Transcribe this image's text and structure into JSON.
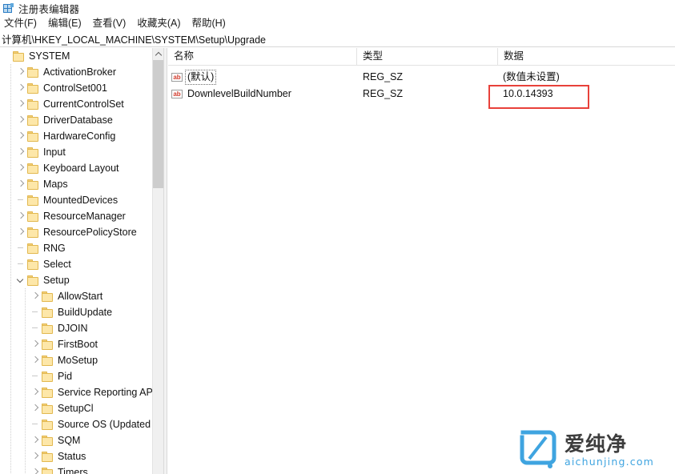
{
  "window": {
    "title": "注册表编辑器",
    "icon": "registry-editor-icon"
  },
  "menubar": {
    "items": [
      {
        "label": "文件(F)",
        "name": "menu-file"
      },
      {
        "label": "编辑(E)",
        "name": "menu-edit"
      },
      {
        "label": "查看(V)",
        "name": "menu-view"
      },
      {
        "label": "收藏夹(A)",
        "name": "menu-favorites"
      },
      {
        "label": "帮助(H)",
        "name": "menu-help"
      }
    ]
  },
  "address": {
    "path": "计算机\\HKEY_LOCAL_MACHINE\\SYSTEM\\Setup\\Upgrade"
  },
  "tree": {
    "nodes": [
      {
        "label": "SYSTEM",
        "depth": 0,
        "state": "expanded-root"
      },
      {
        "label": "ActivationBroker",
        "depth": 1,
        "state": "collapsed"
      },
      {
        "label": "ControlSet001",
        "depth": 1,
        "state": "collapsed"
      },
      {
        "label": "CurrentControlSet",
        "depth": 1,
        "state": "collapsed"
      },
      {
        "label": "DriverDatabase",
        "depth": 1,
        "state": "collapsed"
      },
      {
        "label": "HardwareConfig",
        "depth": 1,
        "state": "collapsed"
      },
      {
        "label": "Input",
        "depth": 1,
        "state": "collapsed"
      },
      {
        "label": "Keyboard Layout",
        "depth": 1,
        "state": "collapsed"
      },
      {
        "label": "Maps",
        "depth": 1,
        "state": "collapsed"
      },
      {
        "label": "MountedDevices",
        "depth": 1,
        "state": "leaf"
      },
      {
        "label": "ResourceManager",
        "depth": 1,
        "state": "collapsed"
      },
      {
        "label": "ResourcePolicyStore",
        "depth": 1,
        "state": "collapsed"
      },
      {
        "label": "RNG",
        "depth": 1,
        "state": "leaf"
      },
      {
        "label": "Select",
        "depth": 1,
        "state": "leaf"
      },
      {
        "label": "Setup",
        "depth": 1,
        "state": "expanded"
      },
      {
        "label": "AllowStart",
        "depth": 2,
        "state": "collapsed"
      },
      {
        "label": "BuildUpdate",
        "depth": 2,
        "state": "leaf"
      },
      {
        "label": "DJOIN",
        "depth": 2,
        "state": "leaf"
      },
      {
        "label": "FirstBoot",
        "depth": 2,
        "state": "collapsed"
      },
      {
        "label": "MoSetup",
        "depth": 2,
        "state": "collapsed"
      },
      {
        "label": "Pid",
        "depth": 2,
        "state": "leaf"
      },
      {
        "label": "Service Reporting API",
        "depth": 2,
        "state": "collapsed"
      },
      {
        "label": "SetupCl",
        "depth": 2,
        "state": "collapsed"
      },
      {
        "label": "Source OS (Updated on",
        "depth": 2,
        "state": "leaf"
      },
      {
        "label": "SQM",
        "depth": 2,
        "state": "collapsed"
      },
      {
        "label": "Status",
        "depth": 2,
        "state": "collapsed"
      },
      {
        "label": "Timers",
        "depth": 2,
        "state": "collapsed"
      }
    ]
  },
  "list": {
    "columns": [
      {
        "label": "名称",
        "name": "column-name"
      },
      {
        "label": "类型",
        "name": "column-type"
      },
      {
        "label": "数据",
        "name": "column-data"
      }
    ],
    "rows": [
      {
        "name": "(默认)",
        "type": "REG_SZ",
        "data": "(数值未设置)",
        "icon": "string-value-icon",
        "focused": true
      },
      {
        "name": "DownlevelBuildNumber",
        "type": "REG_SZ",
        "data": "10.0.14393",
        "icon": "string-value-icon",
        "focused": false
      }
    ]
  },
  "annotation": {
    "color": "#e8413a",
    "target_value": "10.0.14393"
  },
  "watermark": {
    "chinese": "爱纯净",
    "domain": "aichunjing.com",
    "accent": "#3fa4e0"
  }
}
